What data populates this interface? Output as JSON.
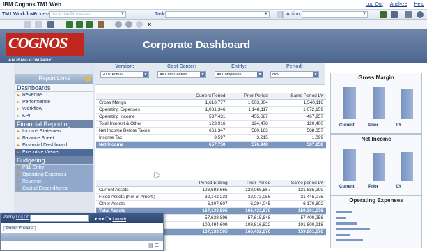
{
  "window": {
    "title": "IBM Cognos TM1 Web",
    "links": [
      "Log Out",
      "Analyze",
      "Help"
    ]
  },
  "workflow_bar": {
    "label": "TM1 Workflow",
    "process_label": "Process",
    "process_placeholder": "No Active Processes",
    "task_label": "Task",
    "action_label": "Action"
  },
  "banner": {
    "logo_text": "COGNOS",
    "logo_sub": "AN IBM® COMPANY",
    "title": "Corporate Dashboard"
  },
  "params": [
    {
      "label": "Version:",
      "value": "2007 Actual"
    },
    {
      "label": "Cost Center:",
      "value": "All Cost Centers"
    },
    {
      "label": "Entity:",
      "value": "All Companies"
    },
    {
      "label": "Period:",
      "value": "Nov"
    }
  ],
  "nav": {
    "report_links": "Report Links",
    "sections": [
      {
        "title": "Dashboards",
        "items": [
          "Revenue",
          "Performance",
          "Workflow",
          "KPI"
        ]
      },
      {
        "title": "Financial Reporting",
        "items": [
          "Income Statement",
          "Balance Sheet",
          "Financial Dashboard",
          "Executive Viewer"
        ]
      },
      {
        "title": "Budgeting",
        "items": [
          "P&L Entry",
          "Operating Expenses",
          "Revenue",
          "Capital Expenditures"
        ]
      }
    ]
  },
  "income_table": {
    "headers": [
      "",
      "Current Period",
      "Prior Period",
      "Same Period LY"
    ],
    "rows": [
      [
        "Gross Margin",
        "1,618,777",
        "1,603,804",
        "1,540,116"
      ],
      [
        "Operating Expenses",
        "1,081,346",
        "1,148,117",
        "1,072,159"
      ],
      [
        "Operating Income",
        "537,431",
        "455,687",
        "467,957"
      ],
      [
        "Total Interest & Other",
        "123,916",
        "124,478",
        "120,400"
      ],
      [
        "Net Income Before Taxes",
        "661,347",
        "580,163",
        "588,357"
      ],
      [
        "Income Tax",
        "3,597",
        "3,215",
        "1,099"
      ],
      [
        "Net Income",
        "657,750",
        "576,948",
        "587,258"
      ]
    ]
  },
  "balance_table": {
    "headers": [
      "",
      "Period Ending",
      "Prior Period",
      "Same period LY"
    ],
    "rows": [
      [
        "Current Assets",
        "128,683,665",
        "128,065,567",
        "121,585,299"
      ],
      [
        "Fixed Assets (Net of Amort.)",
        "32,142,233",
        "32,073,058",
        "31,445,075"
      ],
      [
        "Other Assets",
        "6,307,607",
        "6,294,045",
        "6,170,802"
      ],
      [
        "Total Assets",
        "167,133,505",
        "166,432,670",
        "159,201,176"
      ],
      [
        "",
        "57,638,896",
        "57,615,848",
        "57,400,258"
      ],
      [
        "",
        "109,494,609",
        "108,816,822",
        "101,800,918"
      ],
      [
        "",
        "167,133,505",
        "166,432,670",
        "159,201,176"
      ]
    ]
  },
  "charts": {
    "gross_margin": {
      "title": "Gross Margin",
      "labels": [
        "Current",
        "Prior",
        "LY"
      ],
      "values": [
        1618777,
        1603804,
        1540116
      ]
    },
    "net_income": {
      "title": "Net Income",
      "labels": [
        "Current",
        "Prior",
        "LY"
      ],
      "values": [
        657750,
        576948,
        587258
      ]
    },
    "operating_expenses": {
      "title": "Operating Expenses"
    }
  },
  "popup": {
    "menu": "Penny",
    "logoff": "Log Off",
    "launch": "Launch",
    "folder": "Public Folders"
  }
}
